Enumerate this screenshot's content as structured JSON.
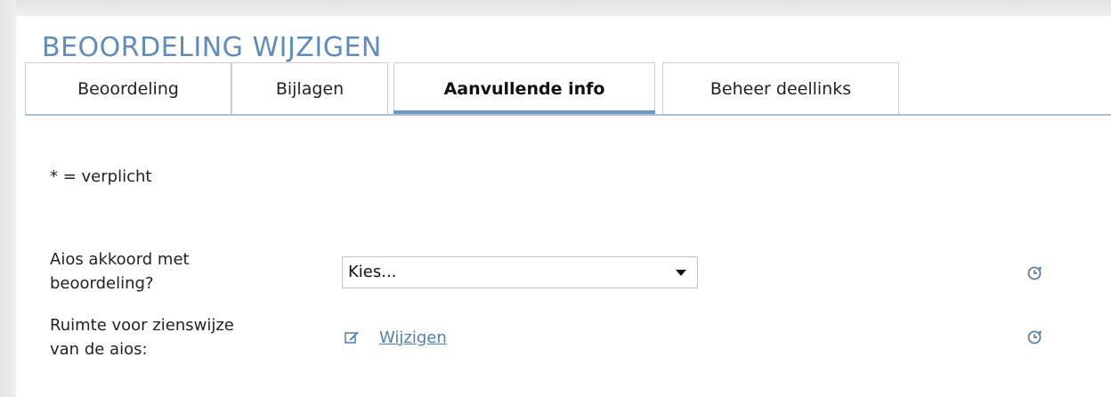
{
  "page": {
    "title": "BEOORDELING WIJZIGEN"
  },
  "tabs": [
    {
      "label": "Beoordeling",
      "active": false
    },
    {
      "label": "Bijlagen",
      "active": false
    },
    {
      "label": "Aanvullende info",
      "active": true
    },
    {
      "label": "Beheer deellinks",
      "active": false
    }
  ],
  "form": {
    "required_note": "* = verplicht",
    "fields": [
      {
        "label_line1": "Aios akkoord met",
        "label_line2": "beoordeling?",
        "control": "select",
        "selected_value": "Kies...",
        "history_icon": "history-icon"
      },
      {
        "label_line1": "Ruimte voor zienswijze",
        "label_line2": "van de aios:",
        "control": "link",
        "link_label": "Wijzigen",
        "link_icon": "edit-icon",
        "history_icon": "history-icon"
      }
    ]
  },
  "colors": {
    "title": "#5d8cbd",
    "active_tab_underline": "#6f98c4",
    "tab_baseline": "#a8c0d8",
    "link": "#4f7fb3",
    "history_icon": "#5b7fa3"
  }
}
